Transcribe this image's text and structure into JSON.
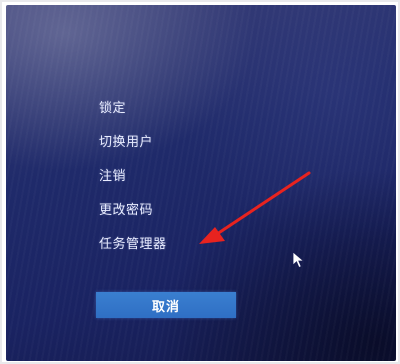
{
  "menu": {
    "items": [
      {
        "label": "锁定"
      },
      {
        "label": "切换用户"
      },
      {
        "label": "注销"
      },
      {
        "label": "更改密码"
      },
      {
        "label": "任务管理器"
      }
    ]
  },
  "cancel_button": {
    "label": "取消"
  },
  "annotation": {
    "color": "#e8231f",
    "icon": "arrow-icon"
  },
  "cursor": {
    "icon": "mouse-pointer-icon"
  }
}
